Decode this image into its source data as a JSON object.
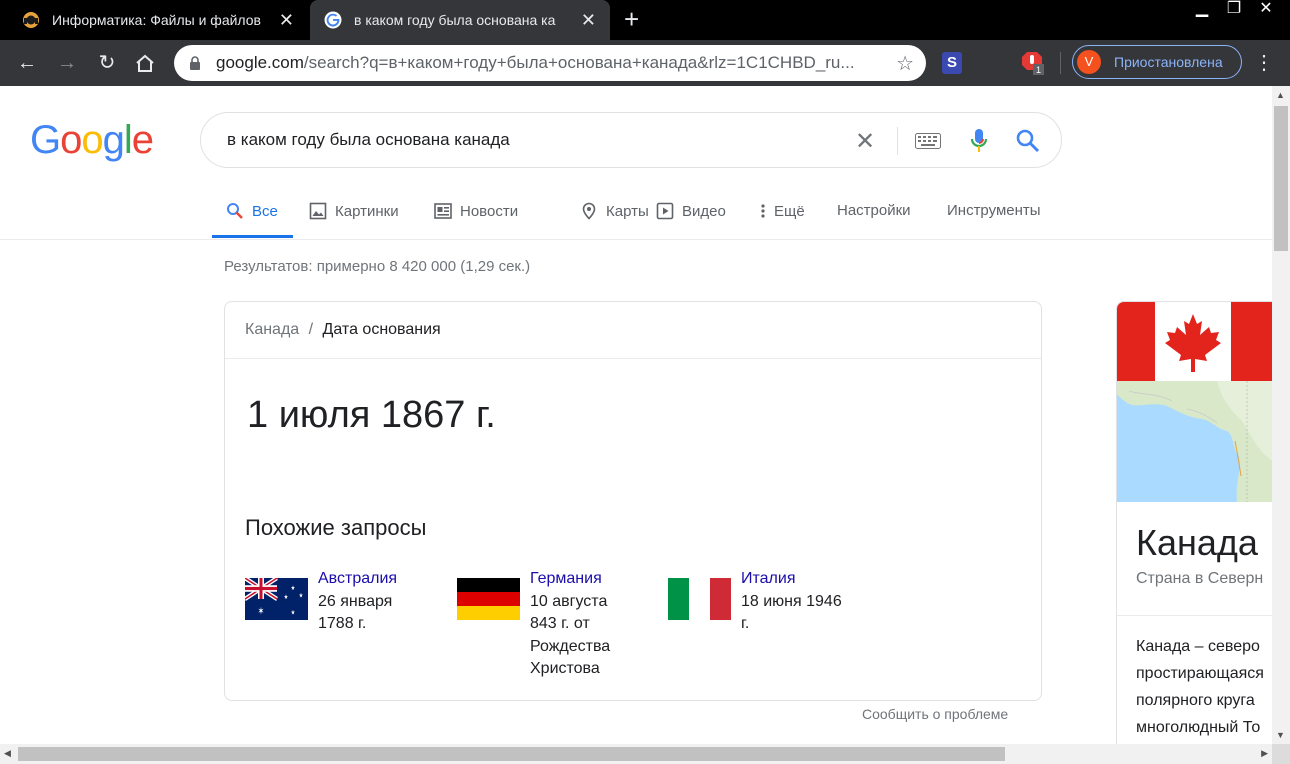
{
  "browser": {
    "tabs": [
      {
        "title": "Информатика: Файлы и файлов",
        "active": false
      },
      {
        "title": "в каком году была основана ка",
        "active": true
      }
    ],
    "new_tab": "+",
    "url_host": "google.com",
    "url_rest": "/search?q=в+каком+году+была+основана+канада&rlz=1C1CHBD_ru...",
    "ext_s_label": "S",
    "ext_badge": "1",
    "profile_initial": "V",
    "profile_label": "Приостановлена"
  },
  "search": {
    "query": "в каком году была основана канада"
  },
  "nav": [
    {
      "label": "Все",
      "icon": "search-icon"
    },
    {
      "label": "Картинки",
      "icon": "image-icon"
    },
    {
      "label": "Новости",
      "icon": "news-icon"
    },
    {
      "label": "Карты",
      "icon": "map-pin-icon"
    },
    {
      "label": "Видео",
      "icon": "play-icon"
    },
    {
      "label": "Ещё",
      "icon": "more-vert-icon"
    },
    {
      "label": "Настройки",
      "icon": ""
    },
    {
      "label": "Инструменты",
      "icon": ""
    }
  ],
  "stats": "Результатов: примерно 8 420 000 (1,29 сек.)",
  "answer_card": {
    "crumb_parent": "Канада",
    "crumb_sep": "/",
    "crumb_current": "Дата основания",
    "answer": "1 июля 1867 г.",
    "related_title": "Похожие запросы",
    "related": [
      {
        "name": "Австралия",
        "lines": [
          "26 января",
          "1788 г."
        ]
      },
      {
        "name": "Германия",
        "lines": [
          "10 августа",
          "843 г. от",
          "Рождества",
          "Христова"
        ]
      },
      {
        "name": "Италия",
        "lines": [
          "18 июня 1946",
          "г."
        ]
      }
    ]
  },
  "report_link": "Сообщить о проблеме",
  "knowledge_panel": {
    "title": "Канада",
    "subtitle": "Страна в Северн",
    "desc_lines": [
      "Канада – северо",
      "простирающаяся",
      "полярного круга",
      "многолюдный То"
    ]
  },
  "colors": {
    "accent": "#1a73e8",
    "link": "#1a0dab",
    "canada_red": "#e3241c"
  }
}
